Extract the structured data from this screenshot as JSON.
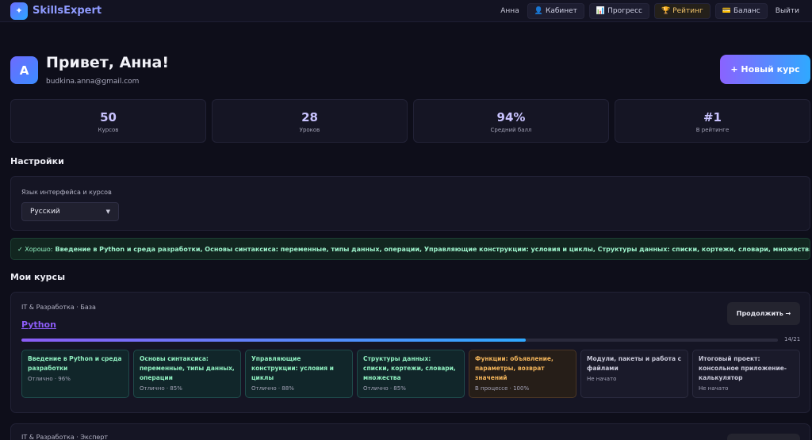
{
  "brand": {
    "name": "SkillsExpert",
    "logo_glyph": "✦"
  },
  "nav": {
    "user": "Анна",
    "items": [
      {
        "icon": "👤",
        "label": "Кабинет"
      },
      {
        "icon": "📊",
        "label": "Прогресс"
      },
      {
        "icon": "🏆",
        "label": "Рейтинг"
      },
      {
        "icon": "💳",
        "label": "Баланс"
      }
    ],
    "logout": "Выйти"
  },
  "profile": {
    "initial": "А",
    "greeting": "Привет, Анна!",
    "email": "budkina.anna@gmail.com",
    "new_course": "+ Новый курс"
  },
  "stats": [
    {
      "value": "50",
      "label": "Курсов"
    },
    {
      "value": "28",
      "label": "Уроков"
    },
    {
      "value": "94%",
      "label": "Средний балл"
    },
    {
      "value": "#1",
      "label": "В рейтинге"
    }
  ],
  "settings": {
    "title": "Настройки",
    "lang_label": "Язык интерфейса и курсов",
    "lang_value": "Русский"
  },
  "notice": {
    "prefix": "✓ Хорошо:",
    "text": "Введение в Python и среда разработки, Основы синтаксиса: переменные, типы данных, операции, Управляющие конструкции: условия и циклы, Структуры данных: списки, кортежи, словари, множества"
  },
  "courses_title": "Мои курсы",
  "course": {
    "meta": "IT & Разработка · База",
    "name": "Python",
    "continue": "Продолжить →",
    "progress_fraction": 0.667,
    "progress_count": "14/21",
    "modules": [
      {
        "title": "Введение в Python и среда разработки",
        "status": "Отлично · 96%",
        "state": "done"
      },
      {
        "title": "Основы синтаксиса: переменные, типы данных, операции",
        "status": "Отлично · 85%",
        "state": "done"
      },
      {
        "title": "Управляющие конструкции: условия и циклы",
        "status": "Отлично · 88%",
        "state": "done"
      },
      {
        "title": "Структуры данных: списки, кортежи, словари, множества",
        "status": "Отлично · 85%",
        "state": "done"
      },
      {
        "title": "Функции: объявление, параметры, возврат значений",
        "status": "В процессе · 100%",
        "state": "progress"
      },
      {
        "title": "Модули, пакеты и работа с файлами",
        "status": "Не начато",
        "state": "todo"
      },
      {
        "title": "Итоговый проект: консольное приложение-калькулятор",
        "status": "Не начато",
        "state": "todo"
      }
    ]
  },
  "course2": {
    "meta": "IT & Разработка · Эксперт"
  }
}
